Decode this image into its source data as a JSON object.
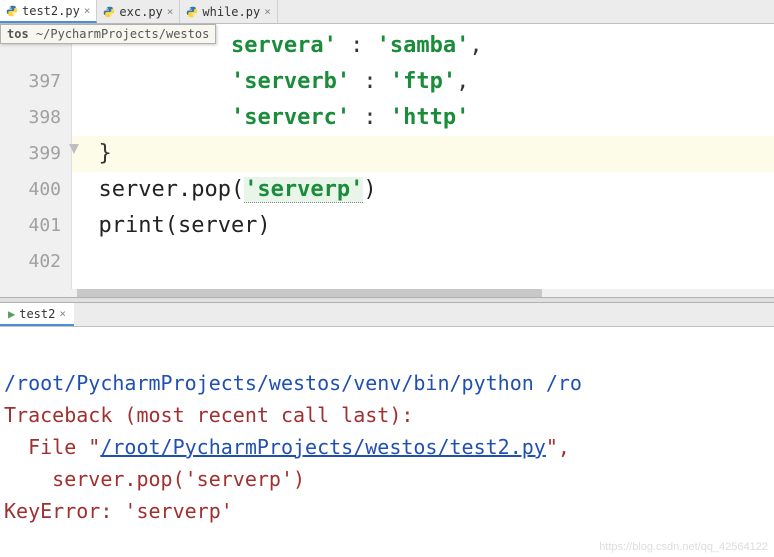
{
  "tabs": [
    {
      "label": "test2.py",
      "active": true
    },
    {
      "label": "exc.py",
      "active": false
    },
    {
      "label": "while.py",
      "active": false
    }
  ],
  "tooltip": {
    "prefix": "tos",
    "path": "~/PycharmProjects/westos"
  },
  "gutter": [
    "",
    "397",
    "398",
    "399",
    "400",
    "401",
    "402"
  ],
  "code": {
    "l0_indent": "            ",
    "l0_k": "servera'",
    "l0_sep": " : ",
    "l0_v": "'samba'",
    "l0_c": ",",
    "l1_indent": "            ",
    "l1_k": "'serverb'",
    "l1_sep": " : ",
    "l1_v": "'ftp'",
    "l1_c": ",",
    "l2_indent": "            ",
    "l2_k": "'serverc'",
    "l2_sep": " : ",
    "l2_v": "'http'",
    "l3_brace": "  }",
    "l4_a": "  server.pop(",
    "l4_arg": "'serverp'",
    "l4_b": ")",
    "l5": "  print(server)",
    "l6": "  "
  },
  "console_tab": "test2",
  "console": {
    "cmd": "/root/PycharmProjects/westos/venv/bin/python /ro",
    "tb": "Traceback (most recent call last):",
    "file_a": "  File \"",
    "file_link": "/root/PycharmProjects/westos/test2.py",
    "file_b": "\",",
    "call": "    server.pop('serverp')",
    "err": "KeyError: 'serverp'"
  },
  "watermark": "https://blog.csdn.net/qq_42564122"
}
